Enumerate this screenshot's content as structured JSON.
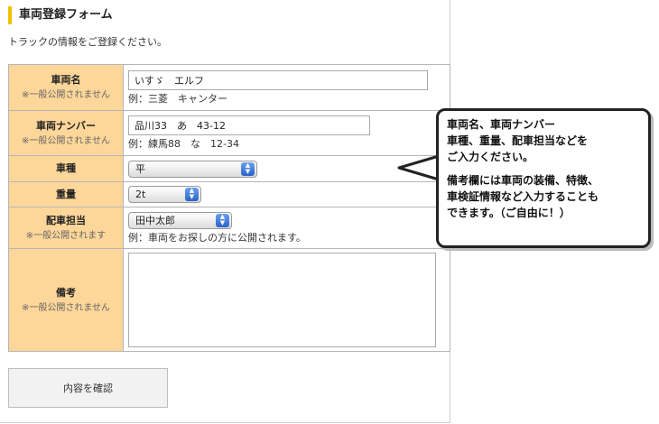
{
  "form": {
    "title": "車両登録フォーム",
    "description": "トラックの情報をご登録ください。"
  },
  "rows": {
    "vehicle_name": {
      "label": "車両名",
      "note": "※一般公開されません",
      "value": "いすゞ　エルフ",
      "example": "例：三菱　キャンター"
    },
    "plate_number": {
      "label": "車両ナンバー",
      "note": "※一般公開されません",
      "value": "品川33　あ　43-12",
      "example": "例：練馬88　な　12-34"
    },
    "vehicle_type": {
      "label": "車種",
      "selected": "平"
    },
    "weight": {
      "label": "重量",
      "selected": "2t"
    },
    "dispatcher": {
      "label": "配車担当",
      "note": "※一般公開されます",
      "selected": "田中太郎",
      "example": "例：車両をお探しの方に公開されます。"
    },
    "remarks": {
      "label": "備考",
      "note": "※一般公開されません",
      "value": ""
    }
  },
  "confirm_button": "内容を確認",
  "callout": {
    "line1": "車両名、車両ナンバー",
    "line2": "車種、重量、配車担当などを",
    "line3": "ご入力ください。",
    "line4": "備考欄には車両の装備、特徴、",
    "line5": "車検証情報など入力することも",
    "line6": "できます。（ご自由に！）"
  },
  "colors": {
    "label_bg": "#fdd699",
    "title_accent": "#f2c200",
    "select_arrow": "#2c64c8"
  }
}
